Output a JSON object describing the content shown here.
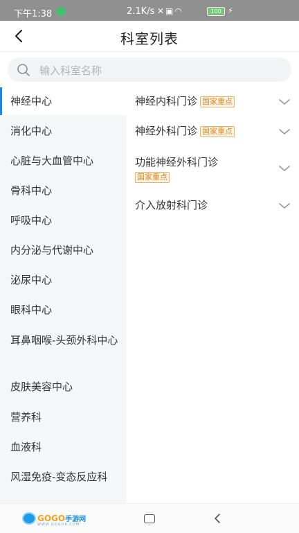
{
  "status_bar": {
    "time": "下午1:38",
    "network_speed": "2.1K/s",
    "battery": "100"
  },
  "header": {
    "title": "科室列表"
  },
  "search": {
    "placeholder": "输入科室名称"
  },
  "departments": [
    {
      "label": "神经中心",
      "active": true
    },
    {
      "label": "消化中心"
    },
    {
      "label": "心脏与大血管中心"
    },
    {
      "label": "骨科中心"
    },
    {
      "label": "呼吸中心"
    },
    {
      "label": "内分泌与代谢中心"
    },
    {
      "label": "泌尿中心"
    },
    {
      "label": "眼科中心"
    },
    {
      "label": "耳鼻咽喉-头颈外科中心"
    },
    {
      "label": "皮肤美容中心"
    },
    {
      "label": "营养科"
    },
    {
      "label": "血液科"
    },
    {
      "label": "风湿免疫-变态反应科"
    }
  ],
  "clinics": [
    {
      "name": "神经内科门诊",
      "tag": "国家重点"
    },
    {
      "name": "神经外科门诊",
      "tag": "国家重点"
    },
    {
      "name": "功能神经外科门诊",
      "tag": "国家重点"
    },
    {
      "name": "介入放射科门诊",
      "tag": ""
    }
  ],
  "bottom_bar": {
    "logo_main": "GOGO",
    "logo_suffix": "手游网",
    "logo_url": "WWW.GOGO8.COM"
  },
  "colors": {
    "accent": "#1e88e5",
    "tag_text": "#d4892a",
    "tag_bg": "#fff4e4",
    "status_bar": "#909090"
  }
}
